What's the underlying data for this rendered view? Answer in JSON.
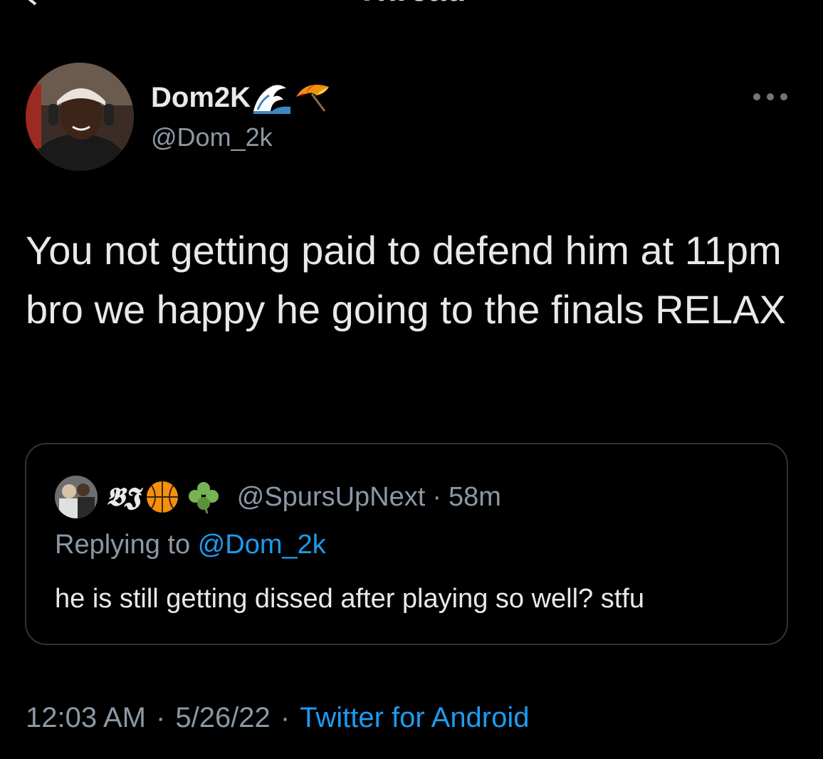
{
  "header": {
    "title": "Thread"
  },
  "tweet": {
    "display_name": "Dom2K",
    "handle": "@Dom_2k",
    "text": "You not getting paid to defend him at 11pm bro we happy he going to the finals RELAX",
    "time": "12:03 AM",
    "date": "5/26/22",
    "source": "Twitter for Android",
    "separator": "·"
  },
  "quote": {
    "display_name": "𝕭𝕵",
    "handle": "@SpursUpNext",
    "age": "58m",
    "separator": "·",
    "replying_prefix": "Replying to",
    "replying_mention": "@Dom_2k",
    "text": "he is still getting dissed after playing so well? stfu"
  },
  "icons": {
    "name_emojis": [
      "water-wave-icon",
      "umbrella-icon"
    ],
    "quote_emojis": [
      "basketball-icon",
      "shamrock-icon"
    ],
    "more": "more-dots-icon",
    "back": "back-arrow-icon"
  },
  "colors": {
    "background": "#000000",
    "text_primary": "#e7e9ea",
    "text_secondary": "#8b98a5",
    "link": "#1d9bf0",
    "border": "#2f3336"
  }
}
